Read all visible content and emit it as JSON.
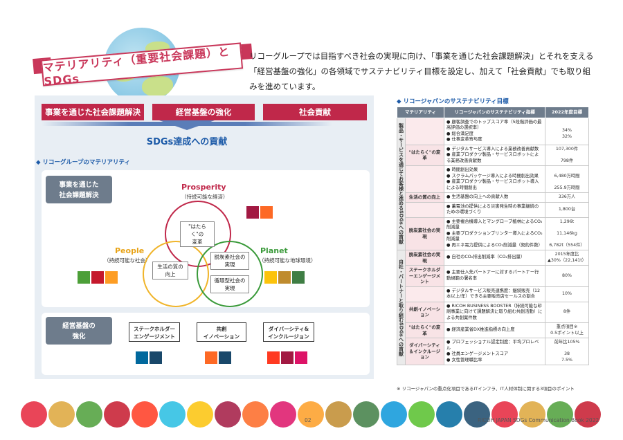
{
  "header": {
    "title": "マテリアリティ（重要社会課題）とSDGs",
    "intro": "リコーグループでは目指すべき社会の実現に向け、「事業を通じた社会課題解決」とそれを支える「経営基盤の強化」の各領域でサステナビリティ目標を設定し、加えて「社会貢献」でも取り組みを進めています。"
  },
  "left": {
    "pills": [
      "事業を通じた社会課題解決",
      "経営基盤の強化",
      "社会貢献"
    ],
    "sdgs": "SDGs達成への貢献",
    "section": "リコーグループのマテリアリティ",
    "business_box": "事業を通じた\n社会課題解決",
    "prosperity": "Prosperity",
    "prosperity_sub": "（持続可能な経済）",
    "people": "People",
    "people_sub": "（持続可能な社会）",
    "planet": "Planet",
    "planet_sub": "（持続可能な地球環境）",
    "hataraku": "\"はたらく\"の\n変革",
    "life": "生活の質の\n向上",
    "decarb": "脱炭素社会の\n実現",
    "circular": "循環型社会の\n実現",
    "mgmt_box": "経営基盤の\n強化",
    "mgmt_items": [
      "ステークホルダー\nエンゲージメント",
      "共創\nイノベーション",
      "ダイバーシティ&\nインクルージョン"
    ]
  },
  "sdg_colors": {
    "1": "#e5243b",
    "3": "#4c9f38",
    "4": "#c5192d",
    "5": "#ff3a21",
    "7": "#fcc30b",
    "8": "#a21942",
    "9": "#fd6925",
    "10": "#dd1367",
    "11": "#fd9d24",
    "12": "#bf8b2e",
    "13": "#3f7e44",
    "16": "#00689d",
    "17": "#19486a"
  },
  "sdg_groups": {
    "prosperity": [
      "8",
      "9"
    ],
    "people": [
      "3",
      "4",
      "11"
    ],
    "planet": [
      "7",
      "12",
      "13"
    ],
    "stake": [
      "16",
      "17"
    ],
    "cocreate": [
      "9",
      "17"
    ],
    "diversity": [
      "5",
      "8",
      "10"
    ]
  },
  "right": {
    "section": "リコージャパンのサステナビリティ目標",
    "headers": [
      "マテリアリティ",
      "リコージャパンのサステナビリティ指標",
      "2022年度目標"
    ],
    "group1": "製品・サービスを通じてお客様と進めるSDGsへの貢献",
    "group2": "自社・パートナーと取り組むSDGsへの貢献",
    "rows": [
      {
        "cat": "",
        "ind": "顧客調査でのトップスコア率（5段階評価の最高評価の選択率）\n総合満足度\n仕事変革寄与度",
        "val": "\n34%\n32%"
      },
      {
        "cat": "\"はたらく\"の変革",
        "ind": "デジタルサービス導入による業務改善貢献数\n産業プロダクツ製品・サービスロボットによる業務改善貢献数",
        "val": "107,300件\n\n798件"
      },
      {
        "cat": "",
        "ind": "時間創出効果\nスクラムパッケージ導入による時間創出効果\n産業プロダクツ製品・サービスロボット導入による時間創出",
        "val": "\n6,480万時間\n\n255.9万時間"
      },
      {
        "cat": "生活の質の向上",
        "ind": "生活基盤の向上への貢献人数",
        "val": "336万人"
      },
      {
        "cat": "",
        "ind": "蓄電池の提供による災害発生時の事業継続のための環境づくり",
        "val": "1,800台"
      },
      {
        "cat": "脱炭素社会の実現",
        "ind": "主要複合機導入とマングローブ植林によるCO₂削減量\n主要プロダクションプリンター導入によるCO₂削減量\n再エネ電力提供によるCO₂削減量（契約件数）",
        "val": "1,296t\n\n11,146kg\n\n6,782t（554件）"
      },
      {
        "cat": "脱炭素社会の実現",
        "ind": "自社のCO₂排出削減率（CO₂排出量）",
        "val": "2015年度比\n▲30%（22,141t）"
      },
      {
        "cat": "ステークホルダーエンゲージメント",
        "ind": "主要仕入先パートナーに対するパートナー行動規範の署名率",
        "val": "80%"
      },
      {
        "cat": "",
        "ind": "デジタルサービス販売連携度：継続販売（12本以上/年）できる主要販売店セールスの割合",
        "val": "10%"
      },
      {
        "cat": "共創イノベーション",
        "ind": "RICOH BUSINESS BOOSTER（持続可能な印刷事業に向けて課題解決に取り組む共創活動）による共創案件数",
        "val": "8件"
      },
      {
        "cat": "\"はたらく\"の変革",
        "ind": "経済産業省DX推進指標の向上度",
        "val": "重点項目※\n0.5ポイント以上"
      },
      {
        "cat": "ダイバーシティ＆インクルージョン",
        "ind": "プロフェッショナル認定制度：平均プロレベル\n社員エンゲージメントスコア\n女性管理職比率",
        "val": "前年比105%\n\n38\n7.5%"
      }
    ],
    "note": "※ リコージャパンの重点化項目であるITインフラ、IT人材体制に関する3項目のポイント"
  },
  "footer": {
    "page": "02",
    "brand": "RICOH JAPAN  SDGs Communication Book 2022"
  },
  "dot_colors": [
    "#e5243b",
    "#dda63a",
    "#4c9f38",
    "#c5192d",
    "#ff3a21",
    "#26bde2",
    "#fcc30b",
    "#a21942",
    "#fd6925",
    "#dd1367",
    "#fd9d24",
    "#bf8b2e",
    "#3f7e44",
    "#0a97d9",
    "#56c02b",
    "#00689d",
    "#19486a",
    "#e5243b",
    "#dda63a",
    "#4c9f38",
    "#c5192d"
  ]
}
